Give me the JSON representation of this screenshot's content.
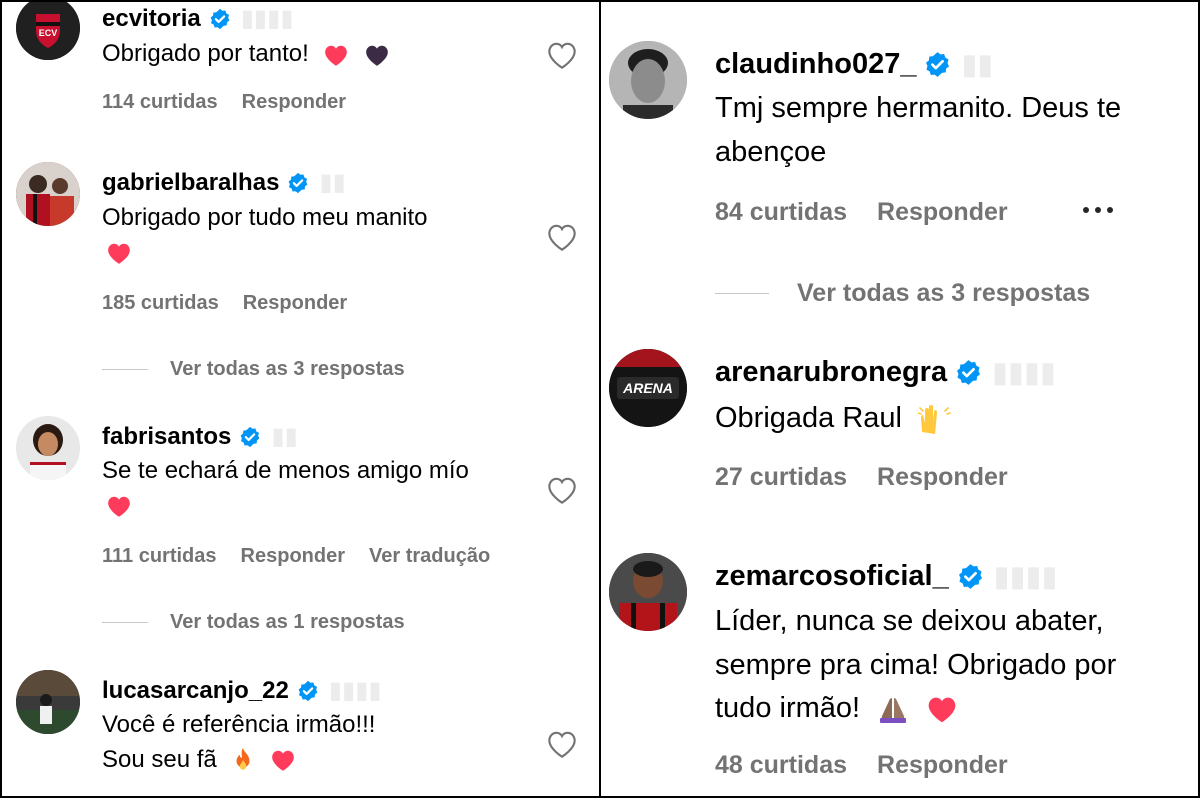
{
  "colors": {
    "verified": "#0095f6",
    "meta_text": "#737373",
    "heart_red": "#ff3040",
    "heart_dark": "#3b2b45"
  },
  "left": {
    "comments": [
      {
        "username": "ecvitoria",
        "text_lines": [
          "Obrigado por tanto!"
        ],
        "likes": "114 curtidas",
        "reply": "Responder"
      },
      {
        "username": "gabrielbaralhas",
        "text_lines": [
          "Obrigado por tudo meu manito"
        ],
        "likes": "185 curtidas",
        "reply": "Responder",
        "view_replies": "Ver todas as 3 respostas"
      },
      {
        "username": "fabrisantos",
        "text_lines": [
          "Se te echará de menos amigo mío"
        ],
        "likes": "111 curtidas",
        "reply": "Responder",
        "translate": "Ver tradução",
        "view_replies": "Ver todas as 1 respostas"
      },
      {
        "username": "lucasarcanjo_22",
        "text_lines": [
          "Você é referência irmão!!!",
          "Sou seu fã"
        ]
      }
    ]
  },
  "right": {
    "comments": [
      {
        "username": "claudinho027_",
        "text_lines": [
          "Tmj sempre hermanito. Deus te",
          "abençoe"
        ],
        "likes": "84 curtidas",
        "reply": "Responder",
        "view_replies": "Ver todas as 3 respostas"
      },
      {
        "username": "arenarubronegra",
        "avatar_text": "ARENA",
        "text_lines": [
          "Obrigada Raul"
        ],
        "likes": "27 curtidas",
        "reply": "Responder"
      },
      {
        "username": "zemarcosoficial_",
        "text_lines": [
          "Líder, nunca se deixou abater,",
          "sempre pra cima! Obrigado por",
          "tudo irmão!"
        ],
        "likes": "48 curtidas",
        "reply": "Responder"
      }
    ]
  }
}
